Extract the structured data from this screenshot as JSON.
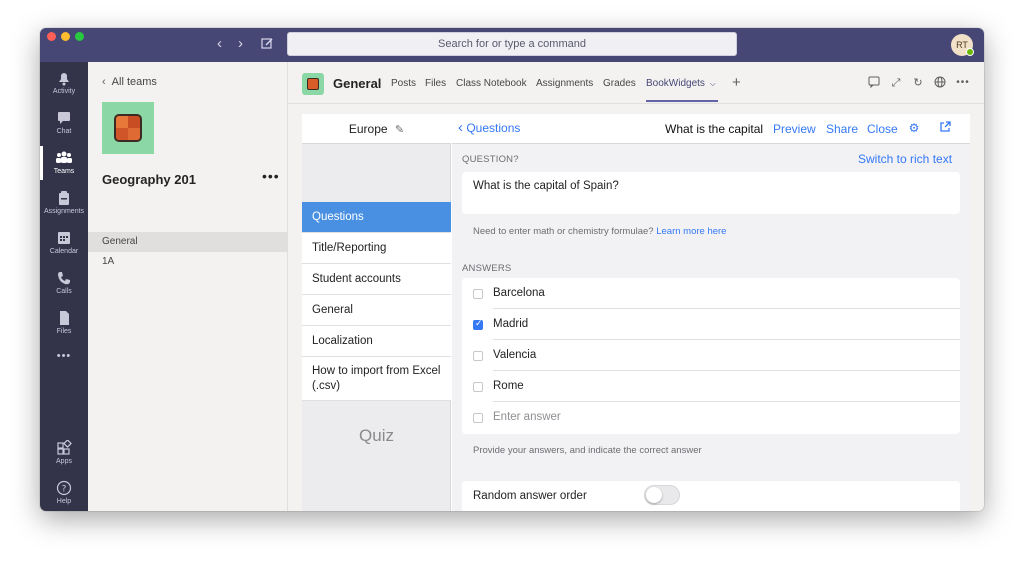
{
  "window": {
    "search_placeholder": "Search for or type a command",
    "avatar_initials": "RT"
  },
  "rail": {
    "items": [
      {
        "label": "Activity",
        "icon": "bell-icon"
      },
      {
        "label": "Chat",
        "icon": "chat-icon"
      },
      {
        "label": "Teams",
        "icon": "teams-icon"
      },
      {
        "label": "Assignments",
        "icon": "assignments-icon"
      },
      {
        "label": "Calendar",
        "icon": "calendar-icon"
      },
      {
        "label": "Calls",
        "icon": "phone-icon"
      },
      {
        "label": "Files",
        "icon": "file-icon"
      }
    ],
    "more": "•••",
    "bottom": [
      {
        "label": "Apps",
        "icon": "apps-icon"
      },
      {
        "label": "Help",
        "icon": "help-icon"
      }
    ]
  },
  "teams_panel": {
    "back_label": "All teams",
    "team_name": "Geography 201",
    "more": "•••",
    "channels": [
      "General",
      "1A"
    ]
  },
  "channel_header": {
    "title": "General",
    "tabs": [
      "Posts",
      "Files",
      "Class Notebook",
      "Assignments",
      "Grades",
      "BookWidgets"
    ],
    "active_tab": "BookWidgets",
    "add": "+"
  },
  "bookwidgets": {
    "widget_title": "Europe",
    "nav_items": [
      "Questions",
      "Title/Reporting",
      "Student accounts",
      "General",
      "Localization",
      "How to import from Excel (.csv)"
    ],
    "active_nav": "Questions",
    "type_label": "Quiz",
    "back_label": "Questions",
    "page_title": "What is the capital",
    "actions": [
      "Preview",
      "Share",
      "Close"
    ],
    "question_label": "QUESTION?",
    "rich_text_link": "Switch to rich text",
    "question_text": "What is the capital of Spain?",
    "formula_hint": "Need to enter math or chemistry formulae?",
    "formula_link": "Learn more here",
    "answers_label": "ANSWERS",
    "answers": [
      {
        "text": "Barcelona",
        "correct": false
      },
      {
        "text": "Madrid",
        "correct": true
      },
      {
        "text": "Valencia",
        "correct": false
      },
      {
        "text": "Rome",
        "correct": false
      }
    ],
    "answer_placeholder": "Enter answer",
    "answers_hint": "Provide your answers, and indicate the correct answer",
    "random_order_label": "Random answer order",
    "random_order_on": false
  }
}
